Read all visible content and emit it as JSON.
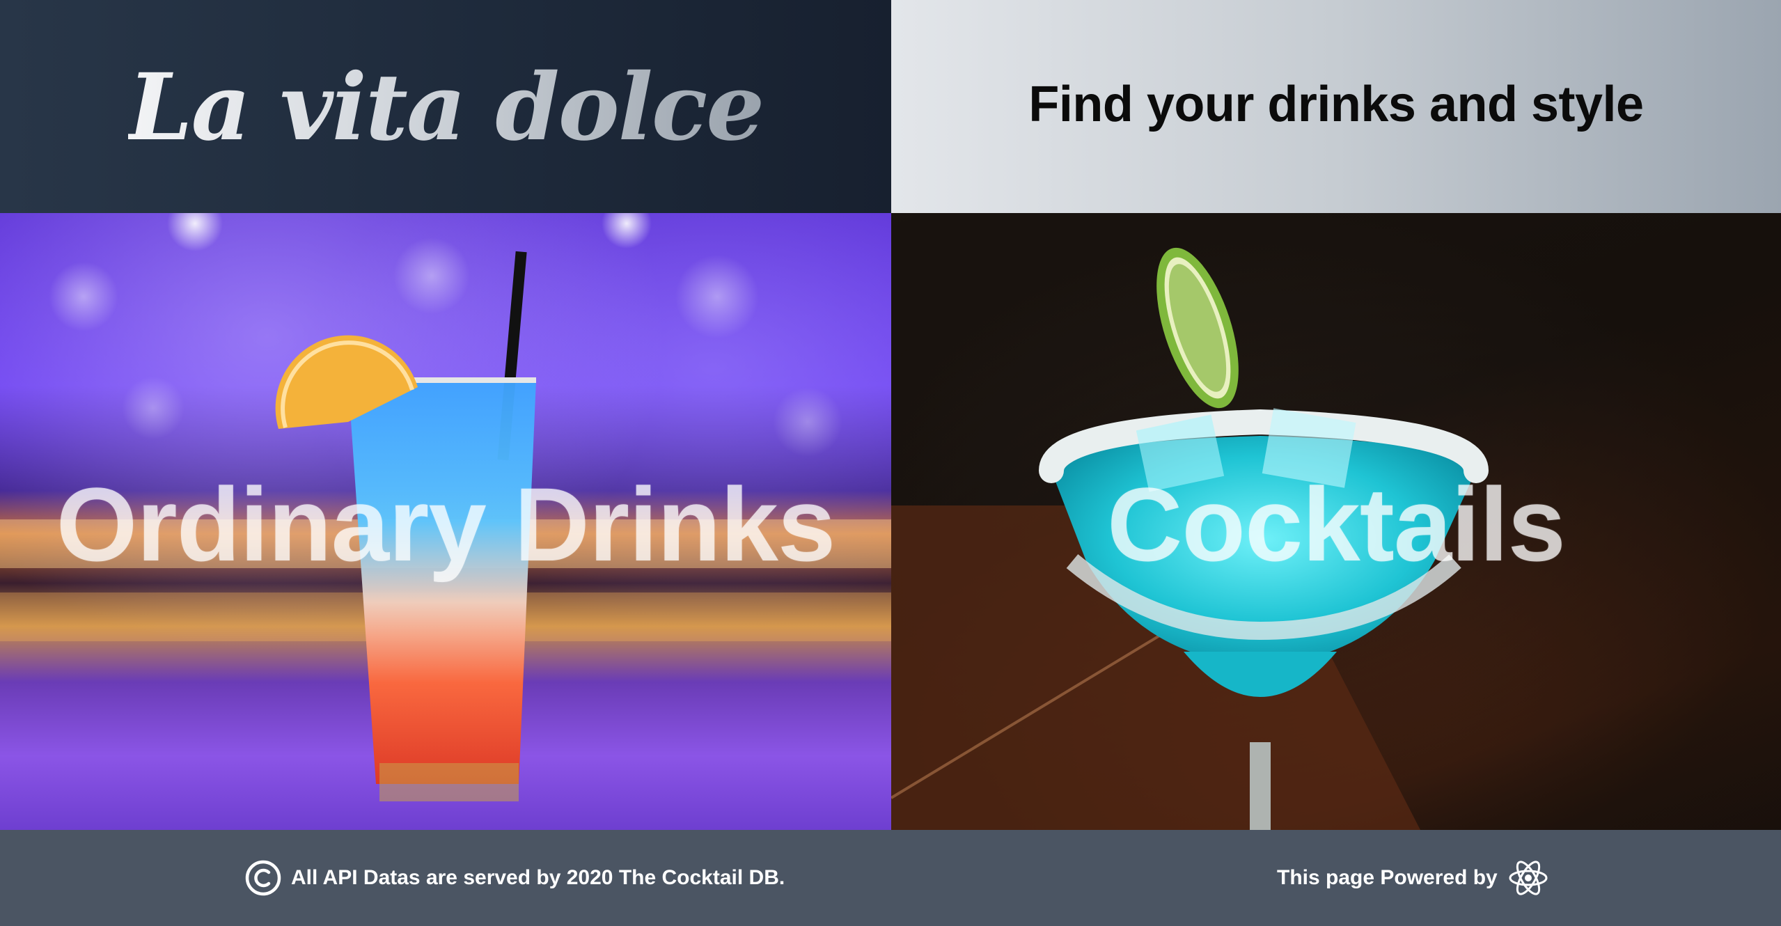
{
  "header": {
    "brand": "La vita dolce",
    "tagline": "Find your drinks and style"
  },
  "panels": [
    {
      "label": "Ordinary Drinks",
      "image": "layered-blue-orange-highball-drink-photo"
    },
    {
      "label": "Cocktails",
      "image": "blue-margarita-with-lime-photo"
    }
  ],
  "footer": {
    "copyright_text": "All API Datas are served by 2020 The Cocktail DB.",
    "copyright_icon": "copyright-icon",
    "powered_text": "This page Powered by",
    "powered_icon": "react-icon"
  },
  "colors": {
    "header_left_bg": "#1e2a3b",
    "header_right_bg": "#c6ccd2",
    "footer_bg": "#4b5563"
  }
}
